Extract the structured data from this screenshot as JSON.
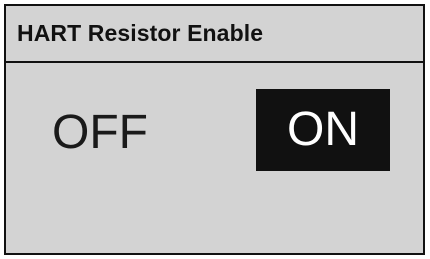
{
  "dialog": {
    "title": "HART Resistor Enable",
    "options": [
      {
        "label": "OFF",
        "selected": false
      },
      {
        "label": "ON",
        "selected": true
      }
    ]
  },
  "colors": {
    "background": "#d3d3d3",
    "border": "#111111",
    "selected_bg": "#111111",
    "selected_text": "#ffffff",
    "text": "#1a1a1a"
  }
}
